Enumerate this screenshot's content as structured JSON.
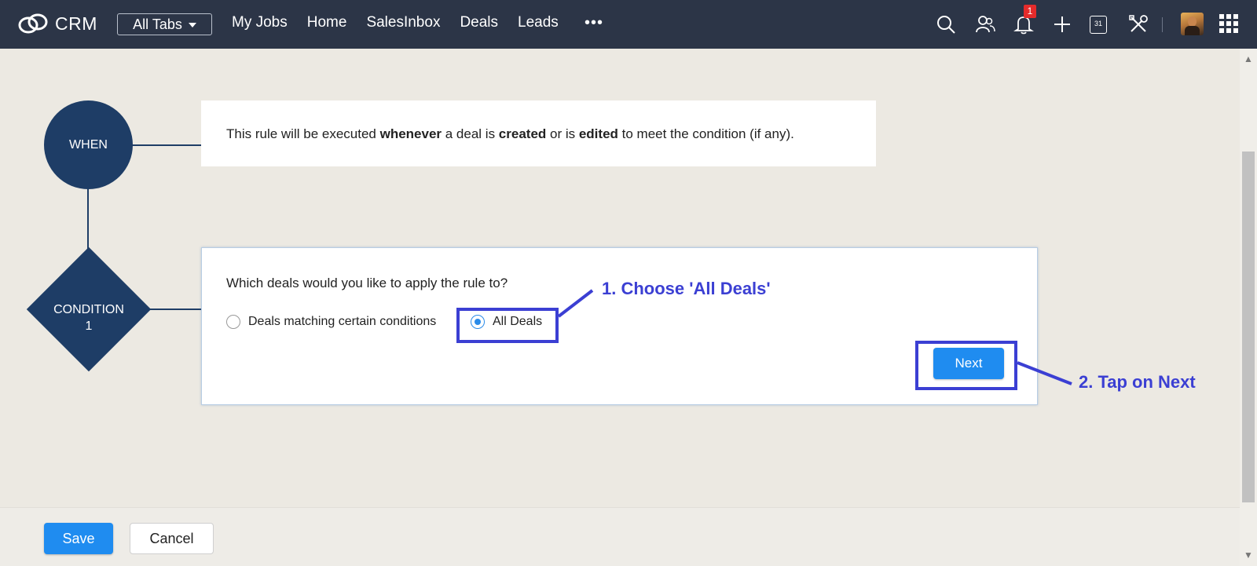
{
  "colors": {
    "topbar_bg": "#2c3547",
    "flow_node": "#1e3d66",
    "primary_button": "#1f8cf0",
    "annotation": "#3b3fd3",
    "badge": "#e52b2b",
    "page_bg": "#ece9e2"
  },
  "topbar": {
    "logo_icon": "crm-logo-icon",
    "logo_text": "CRM",
    "all_tabs_label": "All Tabs",
    "nav_links": [
      "My Jobs",
      "Home",
      "SalesInbox",
      "Deals",
      "Leads"
    ],
    "more_label": "•••",
    "icons": [
      "search-icon",
      "contacts-icon",
      "bell-icon",
      "plus-icon",
      "calendar-icon",
      "tools-icon",
      "avatar",
      "apps-grid-icon"
    ],
    "notification_count": "1",
    "calendar_day": "31"
  },
  "flow": {
    "when_node_label": "WHEN",
    "condition_node_label_line1": "CONDITION",
    "condition_node_label_line2": "1"
  },
  "when_card": {
    "text_1": "This rule will be executed ",
    "bold_1": "whenever",
    "text_2": " a deal is ",
    "bold_2": "created",
    "text_3": " or is ",
    "bold_3": "edited",
    "text_4": " to meet the condition (if any)."
  },
  "condition_card": {
    "question": "Which deals would you like to apply the rule to?",
    "options": [
      {
        "label": "Deals matching certain conditions",
        "selected": false
      },
      {
        "label": "All Deals",
        "selected": true
      }
    ],
    "next_label": "Next"
  },
  "annotations": {
    "step1": "1. Choose 'All Deals'",
    "step2": "2. Tap on Next"
  },
  "footer": {
    "save_label": "Save",
    "cancel_label": "Cancel"
  }
}
